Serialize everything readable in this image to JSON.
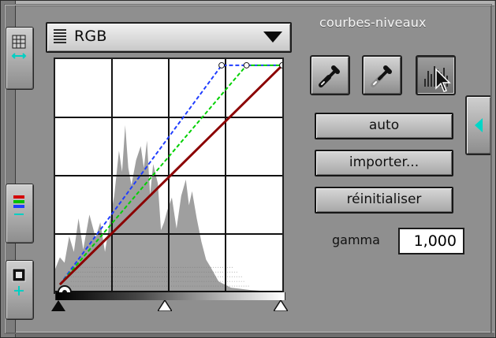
{
  "header": {
    "title": "courbes-niveaux"
  },
  "channel_select": {
    "value": "RGB"
  },
  "tools": {
    "eyedroppers": [
      {
        "name": "black-point-eyedropper-icon"
      },
      {
        "name": "gray-point-eyedropper-icon"
      },
      {
        "name": "histogram-icon"
      }
    ]
  },
  "buttons": {
    "auto": "auto",
    "import": "importer...",
    "reset": "réinitialiser"
  },
  "gamma": {
    "label": "gamma",
    "value": "1,000"
  },
  "colors": {
    "panel_bg": "#8f8f8f",
    "curve_red": "#8b0000",
    "curve_green": "#00d000",
    "curve_blue": "#1e3cff",
    "histogram_fill": "#9a9a9a",
    "accent_teal": "#00d6c7"
  }
}
